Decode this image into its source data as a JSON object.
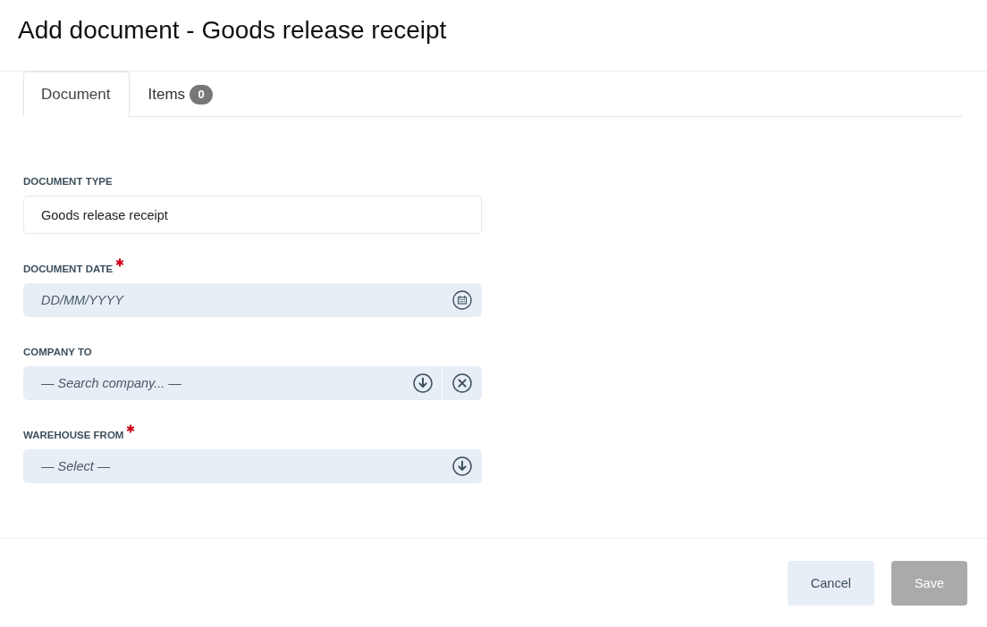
{
  "header": {
    "title": "Add document - Goods release receipt"
  },
  "tabs": [
    {
      "label": "Document",
      "selected": true
    },
    {
      "label": "Items",
      "selected": false,
      "badge": "0"
    }
  ],
  "form": {
    "fields": [
      {
        "kind": "text",
        "label": "DOCUMENT TYPE",
        "required": false,
        "value": "Goods release receipt"
      },
      {
        "kind": "date",
        "label": "DOCUMENT DATE",
        "required": true,
        "placeholder": "DD/MM/YYYY"
      },
      {
        "kind": "search",
        "label": "COMPANY TO",
        "required": false,
        "placeholder": "— Search company... —",
        "clearable": true
      },
      {
        "kind": "select",
        "label": "WAREHOUSE FROM",
        "required": true,
        "placeholder": "— Select —"
      }
    ]
  },
  "footer": {
    "buttons": [
      {
        "label": "Cancel",
        "kind": "secondary",
        "disabled": false
      },
      {
        "label": "Save",
        "kind": "primary",
        "disabled": true
      }
    ]
  }
}
